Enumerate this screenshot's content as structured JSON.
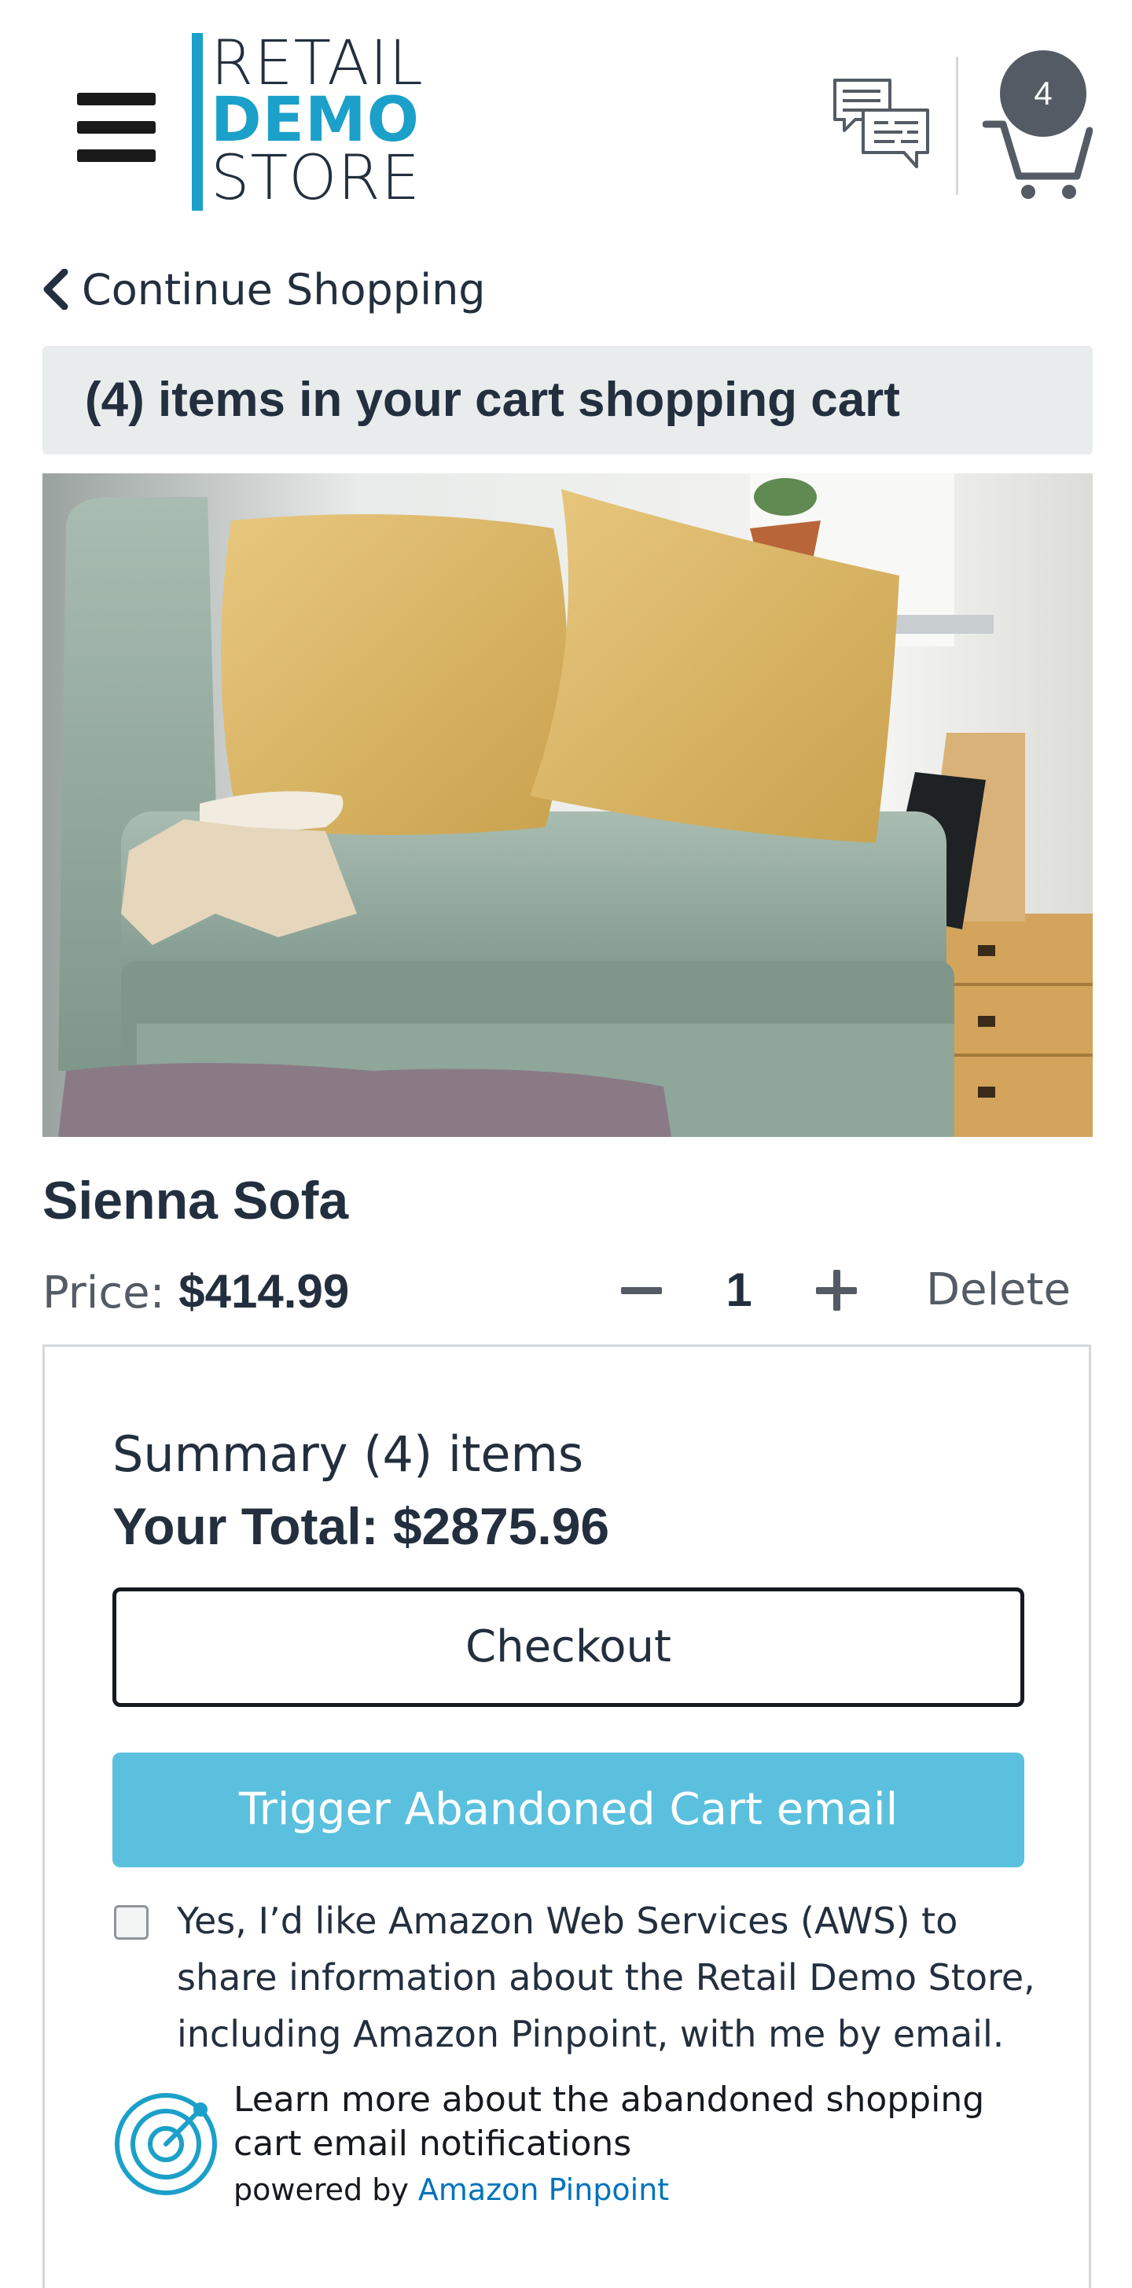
{
  "header": {
    "logo": {
      "line1": "RETAIL",
      "line2": "DEMO",
      "line3": "STORE"
    },
    "cart_count": "4",
    "icons": {
      "menu": "hamburger-menu-icon",
      "chat": "chat-bubbles-icon",
      "cart": "shopping-cart-icon"
    },
    "colors": {
      "brand_blue": "#1ba0c9",
      "dark": "#232f3e",
      "badge": "#545b64"
    }
  },
  "nav": {
    "continue_label": "Continue Shopping"
  },
  "cart": {
    "heading": "(4) items in your cart shopping cart"
  },
  "item": {
    "name": "Sienna Sofa",
    "price_label": "Price:",
    "price_value": "$414.99",
    "quantity": "1",
    "delete_label": "Delete"
  },
  "summary": {
    "title": "Summary (4) items",
    "total": "Your Total: $2875.96",
    "checkout_label": "Checkout",
    "trigger_label": "Trigger Abandoned Cart email",
    "trigger_color": "#5bc0de",
    "consent_text": "Yes, I’d like Amazon Web Services (AWS) to share information about the Retail Demo Store, including Amazon Pinpoint, with me by email.",
    "consent_checked": false,
    "learn_more": "Learn more about the abandoned shopping cart email notifications",
    "powered_by": "powered by",
    "powered_link": "Amazon Pinpoint"
  }
}
